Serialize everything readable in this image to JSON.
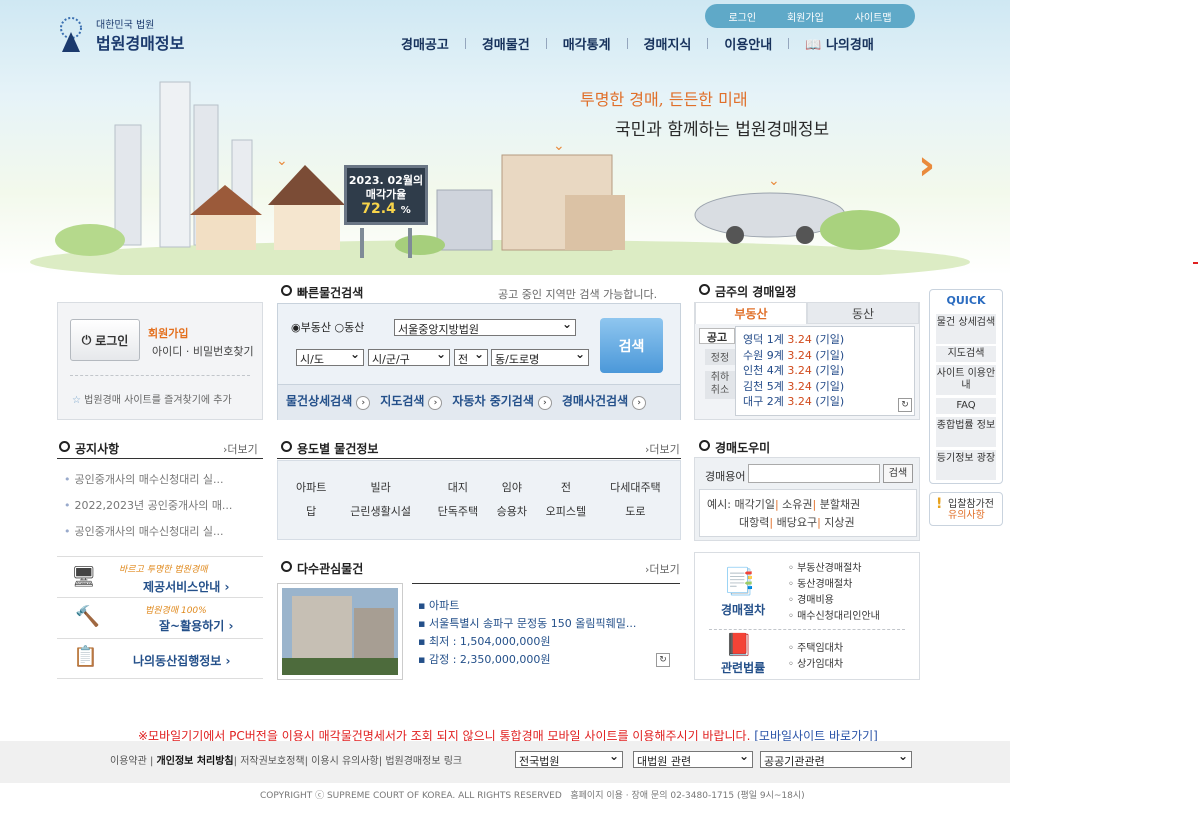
{
  "header": {
    "logo_small": "대한민국 법원",
    "logo_big": "법원경매정보",
    "util": [
      "로그인",
      "회원가입",
      "사이트맵"
    ],
    "gnb": [
      "경매공고",
      "경매물건",
      "매각통계",
      "경매지식",
      "이용안내",
      "나의경매"
    ]
  },
  "banner": {
    "slogan1": "투명한 경매, 든든한 미래",
    "slogan2": "국민과 함께하는 법원경매정보",
    "billboard_line1": "2023. 02월의",
    "billboard_line2": "매각가율",
    "billboard_rate": "72.4",
    "billboard_unit": "%"
  },
  "login": {
    "button": "로그인",
    "signup": "회원가입",
    "find": "아이디 · 비밀번호찾기",
    "favorite": "법원경매 사이트를 즐겨찾기에 추가"
  },
  "quicksearch": {
    "title": "빠른물건검색",
    "note": "공고 중인 지역만 검색 가능합니다.",
    "radio1": "부동산",
    "radio2": "동산",
    "court": "서울중앙지방법원",
    "sido": "시/도",
    "sigungu": "시/군/구",
    "jeon": "전",
    "dong": "동/도로명",
    "search": "검색",
    "links": [
      "물건상세검색",
      "지도검색",
      "자동차 중기검색",
      "경매사건검색"
    ]
  },
  "notice": {
    "title": "공지사항",
    "more": "더보기",
    "items": [
      "공인중개사의 매수신청대리 실...",
      "2022,2023년 공인중개사의 매...",
      "공인중개사의 매수신청대리 실..."
    ]
  },
  "usage": {
    "title": "용도별 물건정보",
    "more": "더보기",
    "row1": [
      "아파트",
      "빌라",
      "대지",
      "임야",
      "전",
      "다세대주택"
    ],
    "row2": [
      "답",
      "근린생활시설",
      "단독주택",
      "승용차",
      "오피스텔",
      "도로"
    ]
  },
  "services": [
    {
      "tag": "바르고 투명한 법원경매",
      "label": "제공서비스안내"
    },
    {
      "tag": "법원경매 100%",
      "label": "잘~활용하기"
    },
    {
      "tag": "",
      "label": "나의동산집행정보"
    }
  ],
  "interest": {
    "title": "다수관심물건",
    "more": "더보기",
    "type": "아파트",
    "address": "서울특별시 송파구 문정동 150 올림픽훼밀...",
    "min": "최저 : 1,504,000,000원",
    "appraisal": "감정 : 2,350,000,000원"
  },
  "schedule": {
    "title": "금주의 경매일정",
    "tab1": "부동산",
    "tab2": "동산",
    "side": [
      "공고",
      "정정",
      "취하 취소"
    ],
    "items": [
      {
        "court": "영덕 1계",
        "date": "3.24",
        "state": "(기일)"
      },
      {
        "court": "수원 9계",
        "date": "3.24",
        "state": "(기일)"
      },
      {
        "court": "인천 4계",
        "date": "3.24",
        "state": "(기일)"
      },
      {
        "court": "김천 5계",
        "date": "3.24",
        "state": "(기일)"
      },
      {
        "court": "대구 2계",
        "date": "3.24",
        "state": "(기일)"
      }
    ]
  },
  "helper": {
    "title": "경매도우미",
    "label": "경매용어",
    "search": "검색",
    "example": "예시:",
    "terms1": [
      "매각기일",
      "소유권",
      "분할채권"
    ],
    "terms2": [
      "대항력",
      "배당요구",
      "지상권"
    ]
  },
  "procedure": {
    "title1": "경매절차",
    "items1": [
      "부동산경매절차",
      "동산경매절차",
      "경매비용",
      "매수신청대리인안내"
    ],
    "title2": "관련법률",
    "items2": [
      "주택임대차",
      "상가임대차"
    ]
  },
  "quick": {
    "title": "QUICK",
    "items": [
      "물건 상세검색",
      "지도검색",
      "사이트 이용안내",
      "FAQ",
      "종합법률 정보",
      "등기정보 광장"
    ],
    "notice_l1": "입찰참가전",
    "notice_l2": "유의사항"
  },
  "mobile_notice": "※모바일기기에서 PC버전을 이용시 매각물건명세서가 조회 되지 않으니 통합경매 모바일 사이트를 이용해주시기 바랍니다.",
  "mobile_link": "[모바일사이트 바로가기]",
  "footer": {
    "links": [
      "이용약관",
      "개인정보 처리방침",
      "저작권보호정책",
      "이용시 유의사항",
      "법원경매정보 링크"
    ],
    "sel1": "전국법원",
    "sel2": "대법원 관련",
    "sel3": "공공기관관련",
    "copyright": "COPYRIGHT ⓒ SUPREME COURT OF KOREA. ALL RIGHTS RESERVED",
    "contact": "홈페이지 이용 · 장애 문의 02-3480-1715 (평일 9시~18시)"
  }
}
